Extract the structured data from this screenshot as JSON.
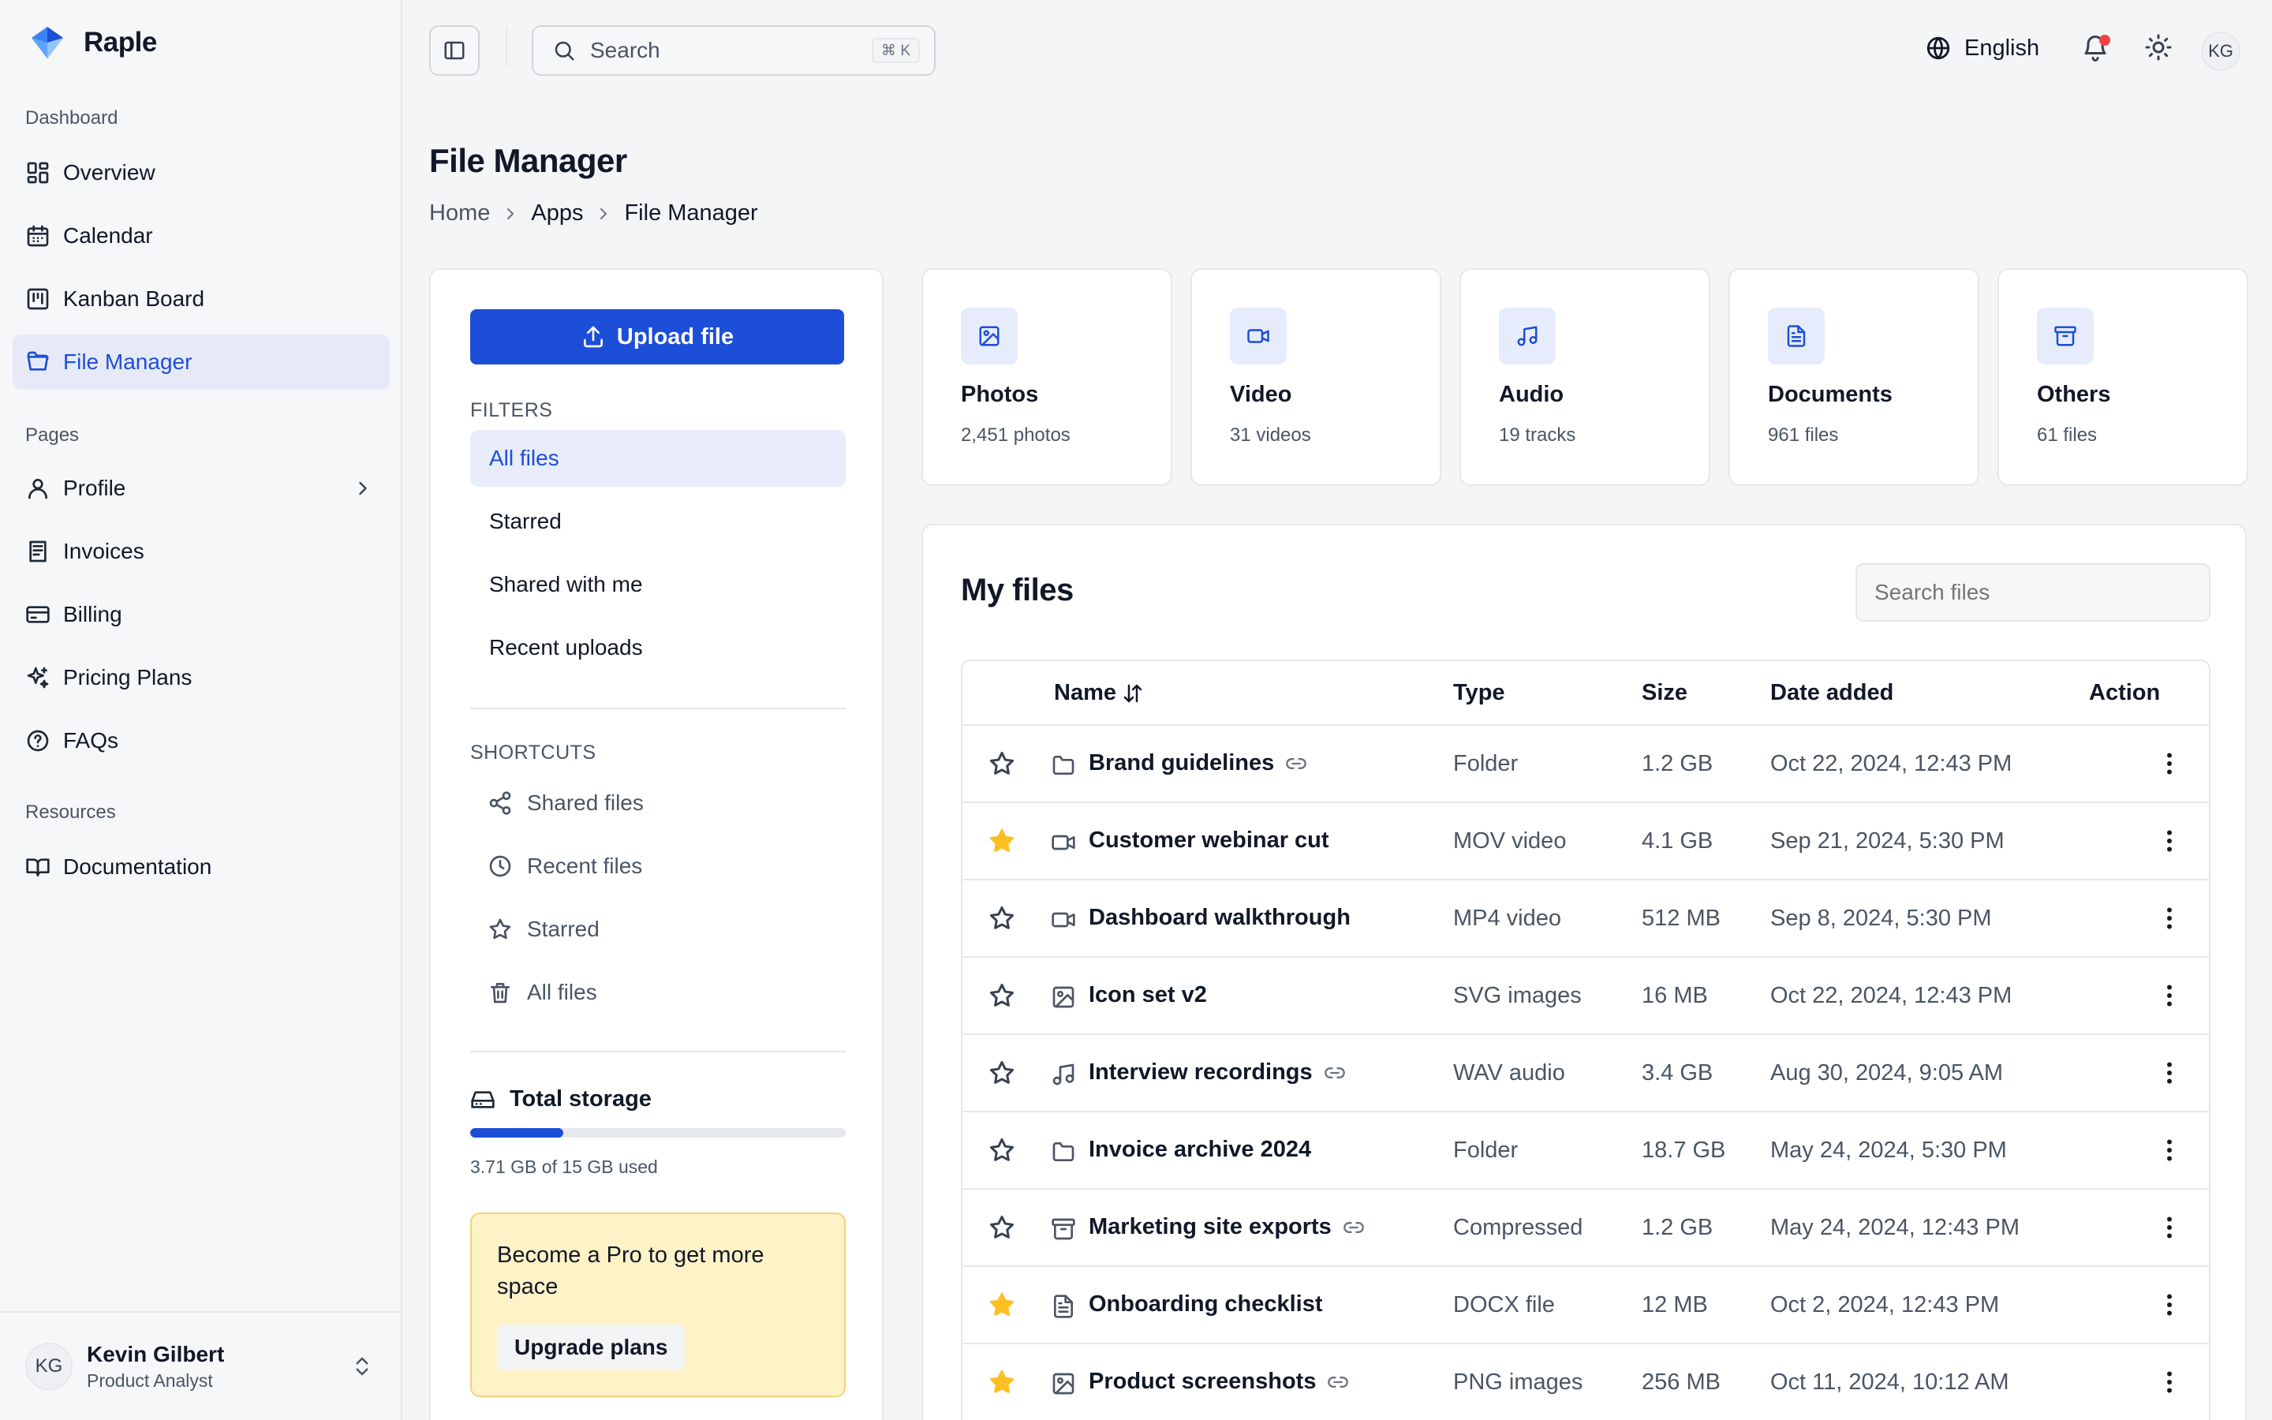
{
  "brand": {
    "name": "Raple"
  },
  "sidebar": {
    "sections": {
      "dashboard": "Dashboard",
      "pages": "Pages",
      "resources": "Resources"
    },
    "items": [
      {
        "label": "Overview",
        "icon": "layout-grid-icon"
      },
      {
        "label": "Calendar",
        "icon": "calendar-icon"
      },
      {
        "label": "Kanban Board",
        "icon": "kanban-icon"
      },
      {
        "label": "File Manager",
        "icon": "folder-open-icon",
        "active": true
      },
      {
        "label": "Profile",
        "icon": "user-icon"
      },
      {
        "label": "Invoices",
        "icon": "receipt-icon"
      },
      {
        "label": "Billing",
        "icon": "credit-card-icon"
      },
      {
        "label": "Pricing Plans",
        "icon": "sparkles-icon"
      },
      {
        "label": "FAQs",
        "icon": "help-circle-icon"
      },
      {
        "label": "Documentation",
        "icon": "book-open-icon"
      }
    ],
    "user": {
      "initials": "KG",
      "name": "Kevin Gilbert",
      "role": "Product Analyst"
    }
  },
  "topbar": {
    "search_placeholder": "Search",
    "shortcut": "⌘ K",
    "language": "English",
    "avatar_initials": "KG"
  },
  "page": {
    "title": "File Manager",
    "breadcrumb": [
      "Home",
      "Apps",
      "File Manager"
    ]
  },
  "filters_panel": {
    "upload_label": "Upload file",
    "filters_heading": "FILTERS",
    "filters": [
      "All files",
      "Starred",
      "Shared with me",
      "Recent uploads"
    ],
    "active_filter": "All files",
    "shortcuts_heading": "SHORTCUTS",
    "shortcuts": [
      {
        "label": "Shared files",
        "icon": "share-icon"
      },
      {
        "label": "Recent files",
        "icon": "clock-icon"
      },
      {
        "label": "Starred",
        "icon": "star-icon"
      },
      {
        "label": "All files",
        "icon": "trash-icon"
      }
    ],
    "storage": {
      "title": "Total storage",
      "used_text": "3.71 GB of 15 GB used",
      "used_fraction": 0.247
    },
    "promo": {
      "text": "Become a Pro to get more space",
      "button": "Upgrade plans"
    }
  },
  "categories": [
    {
      "title": "Photos",
      "count": "2,451 photos",
      "icon": "image-icon"
    },
    {
      "title": "Video",
      "count": "31 videos",
      "icon": "video-icon"
    },
    {
      "title": "Audio",
      "count": "19 tracks",
      "icon": "music-icon"
    },
    {
      "title": "Documents",
      "count": "961 files",
      "icon": "file-text-icon"
    },
    {
      "title": "Others",
      "count": "61 files",
      "icon": "archive-icon"
    }
  ],
  "files": {
    "title": "My files",
    "search_placeholder": "Search files",
    "columns": {
      "name": "Name",
      "type": "Type",
      "size": "Size",
      "date": "Date added",
      "action": "Action"
    },
    "rows": [
      {
        "name": "Brand guidelines",
        "type": "Folder",
        "size": "1.2 GB",
        "date": "Oct 22, 2024, 12:43 PM",
        "starred": false,
        "shared": true,
        "icon": "folder-icon"
      },
      {
        "name": "Customer webinar cut",
        "type": "MOV video",
        "size": "4.1 GB",
        "date": "Sep 21, 2024, 5:30 PM",
        "starred": true,
        "shared": false,
        "icon": "video-icon"
      },
      {
        "name": "Dashboard walkthrough",
        "type": "MP4 video",
        "size": "512 MB",
        "date": "Sep 8, 2024, 5:30 PM",
        "starred": false,
        "shared": false,
        "icon": "video-icon"
      },
      {
        "name": "Icon set v2",
        "type": "SVG images",
        "size": "16 MB",
        "date": "Oct 22, 2024, 12:43 PM",
        "starred": false,
        "shared": false,
        "icon": "image-icon"
      },
      {
        "name": "Interview recordings",
        "type": "WAV audio",
        "size": "3.4 GB",
        "date": "Aug 30, 2024, 9:05 AM",
        "starred": false,
        "shared": true,
        "icon": "music-icon"
      },
      {
        "name": "Invoice archive 2024",
        "type": "Folder",
        "size": "18.7 GB",
        "date": "May 24, 2024, 5:30 PM",
        "starred": false,
        "shared": false,
        "icon": "folder-icon"
      },
      {
        "name": "Marketing site exports",
        "type": "Compressed",
        "size": "1.2 GB",
        "date": "May 24, 2024, 12:43 PM",
        "starred": false,
        "shared": true,
        "icon": "archive-icon"
      },
      {
        "name": "Onboarding checklist",
        "type": "DOCX file",
        "size": "12 MB",
        "date": "Oct 2, 2024, 12:43 PM",
        "starred": true,
        "shared": false,
        "icon": "file-text-icon"
      },
      {
        "name": "Product screenshots",
        "type": "PNG images",
        "size": "256 MB",
        "date": "Oct 11, 2024, 10:12 AM",
        "starred": true,
        "shared": true,
        "icon": "image-icon"
      }
    ]
  },
  "colors": {
    "accent": "#1d4ed8",
    "star_filled": "#fbbf24",
    "notification": "#ef4444",
    "promo_bg": "#fef2c7"
  }
}
